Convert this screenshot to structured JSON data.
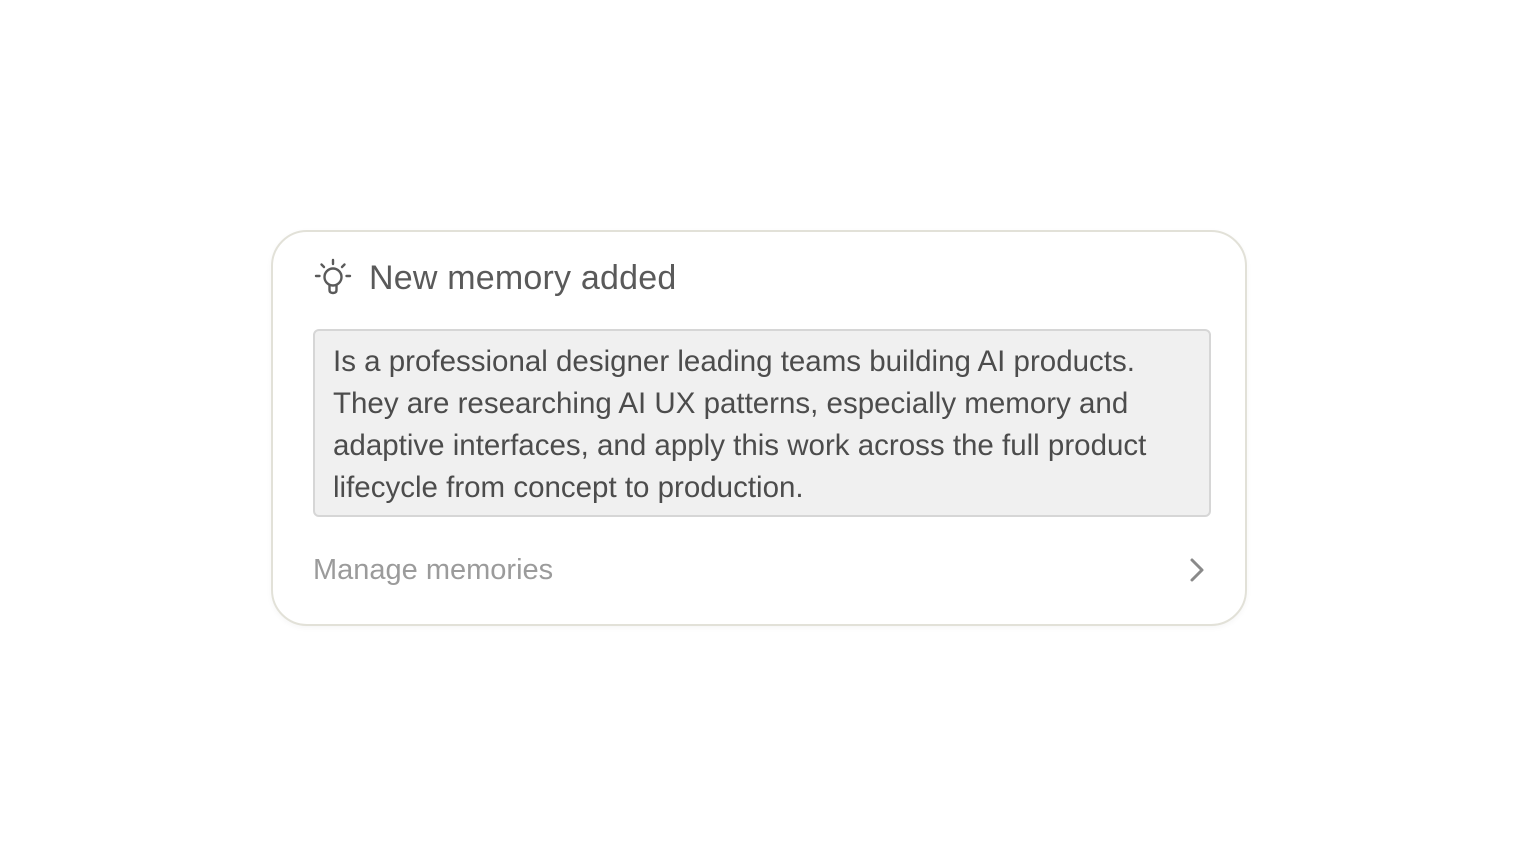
{
  "notification": {
    "icon": "lightbulb-icon",
    "title": "New memory added",
    "memory_text": "Is a professional designer leading teams building AI products. They are researching AI UX patterns, especially memory and adaptive interfaces, and apply this work across the full product lifecycle from concept to production.",
    "manage_label": "Manage memories",
    "manage_icon": "chevron-right-icon"
  },
  "colors": {
    "card_border": "#e2e1d8",
    "memory_bg": "#f0f0f0",
    "title_text": "#5a5a5a",
    "link_text": "#9b9b9b"
  }
}
